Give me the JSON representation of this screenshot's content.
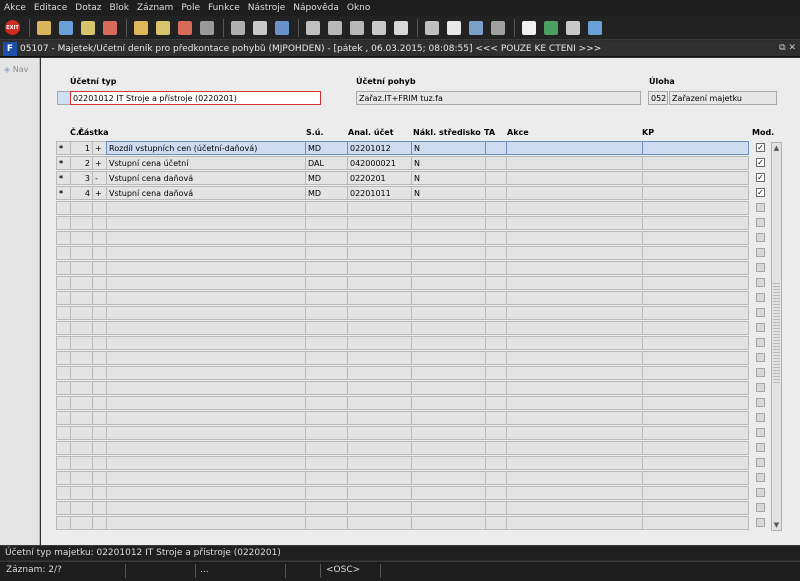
{
  "menu": [
    "Akce",
    "Editace",
    "Dotaz",
    "Blok",
    "Záznam",
    "Pole",
    "Funkce",
    "Nástroje",
    "Nápověda",
    "Okno"
  ],
  "toolbar": {
    "exit_label": "EXIT",
    "icons": [
      "save-icon",
      "print-preview-icon",
      "new-record-icon",
      "delete-record-icon",
      "open-folder-icon",
      "insert-icon",
      "remove-icon",
      "filter-icon",
      "print-icon",
      "attach-icon",
      "mail-icon",
      "cut-icon",
      "copy-icon",
      "paste-icon",
      "duplicate-icon",
      "calendar-icon",
      "report-icon",
      "document-icon",
      "globe-icon",
      "settings-icon",
      "sum-icon",
      "excel-icon",
      "export-icon",
      "info-icon"
    ]
  },
  "window": {
    "logo": "F",
    "title": "05107 - Majetek/Účetní deník pro předkontace pohybů (MJPOHDEN) - [pátek , 06.03.2015; 08:08:55] <<< POUZE KE ČTENÍ >>>",
    "controls": "⧉ ✕"
  },
  "nav": {
    "label": "Nav"
  },
  "header": {
    "ucetni_typ_label": "Účetní typ",
    "ucetni_typ_value": "02201012 IT Stroje a přístroje (0220201)",
    "ucetni_pohyb_label": "Účetní pohyb",
    "ucetni_pohyb_value": "Zařaz.IT+FRIM tuz.fa",
    "uloha_label": "Úloha",
    "uloha_code": "052",
    "uloha_value": "Zařazení majetku"
  },
  "columns": {
    "cr": "Č.r.",
    "castka": "Částka",
    "su": "S.ú.",
    "anal": "Anal. účet",
    "nakl": "Nákl. středisko",
    "ta": "TA",
    "akce": "Akce",
    "kp": "KP",
    "mod": "Mod."
  },
  "rows": [
    {
      "mark": "*",
      "cr": "1",
      "sign": "+",
      "castka": "Rozdíl vstupních cen (účetní-daňová)",
      "su": "MD",
      "anal": "02201012",
      "nakl": "N",
      "mod": "✓"
    },
    {
      "mark": "*",
      "cr": "2",
      "sign": "+",
      "castka": "Vstupní cena účetní",
      "su": "DAL",
      "anal": "042000021",
      "nakl": "N",
      "mod": "✓"
    },
    {
      "mark": "*",
      "cr": "3",
      "sign": "-",
      "castka": "Vstupní cena daňová",
      "su": "MD",
      "anal": "0220201",
      "nakl": "N",
      "mod": "✓"
    },
    {
      "mark": "*",
      "cr": "4",
      "sign": "+",
      "castka": "Vstupní cena daňová",
      "su": "MD",
      "anal": "02201011",
      "nakl": "N",
      "mod": "✓"
    }
  ],
  "status": {
    "message": "Účetní typ majetku: 02201012 IT Stroje a přístroje (0220201)",
    "record": "Záznam: 2/?",
    "ellipsis": "...",
    "osc": "<OSC>"
  },
  "colors": {
    "accent": "#1b4fa8",
    "selected_row": "#cddcf0",
    "error_border": "#d4312c"
  }
}
